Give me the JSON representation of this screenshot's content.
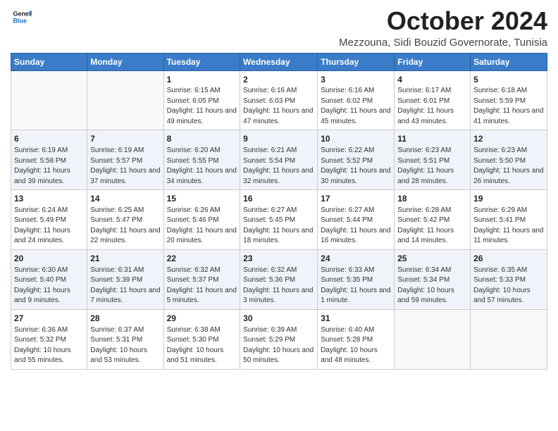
{
  "header": {
    "logo_line1": "General",
    "logo_line2": "Blue",
    "month_title": "October 2024",
    "subtitle": "Mezzouna, Sidi Bouzid Governorate, Tunisia"
  },
  "weekdays": [
    "Sunday",
    "Monday",
    "Tuesday",
    "Wednesday",
    "Thursday",
    "Friday",
    "Saturday"
  ],
  "weeks": [
    [
      {
        "day": "",
        "info": ""
      },
      {
        "day": "",
        "info": ""
      },
      {
        "day": "1",
        "info": "Sunrise: 6:15 AM\nSunset: 6:05 PM\nDaylight: 11 hours and 49 minutes."
      },
      {
        "day": "2",
        "info": "Sunrise: 6:16 AM\nSunset: 6:03 PM\nDaylight: 11 hours and 47 minutes."
      },
      {
        "day": "3",
        "info": "Sunrise: 6:16 AM\nSunset: 6:02 PM\nDaylight: 11 hours and 45 minutes."
      },
      {
        "day": "4",
        "info": "Sunrise: 6:17 AM\nSunset: 6:01 PM\nDaylight: 11 hours and 43 minutes."
      },
      {
        "day": "5",
        "info": "Sunrise: 6:18 AM\nSunset: 5:59 PM\nDaylight: 11 hours and 41 minutes."
      }
    ],
    [
      {
        "day": "6",
        "info": "Sunrise: 6:19 AM\nSunset: 5:58 PM\nDaylight: 11 hours and 39 minutes."
      },
      {
        "day": "7",
        "info": "Sunrise: 6:19 AM\nSunset: 5:57 PM\nDaylight: 11 hours and 37 minutes."
      },
      {
        "day": "8",
        "info": "Sunrise: 6:20 AM\nSunset: 5:55 PM\nDaylight: 11 hours and 34 minutes."
      },
      {
        "day": "9",
        "info": "Sunrise: 6:21 AM\nSunset: 5:54 PM\nDaylight: 11 hours and 32 minutes."
      },
      {
        "day": "10",
        "info": "Sunrise: 6:22 AM\nSunset: 5:52 PM\nDaylight: 11 hours and 30 minutes."
      },
      {
        "day": "11",
        "info": "Sunrise: 6:23 AM\nSunset: 5:51 PM\nDaylight: 11 hours and 28 minutes."
      },
      {
        "day": "12",
        "info": "Sunrise: 6:23 AM\nSunset: 5:50 PM\nDaylight: 11 hours and 26 minutes."
      }
    ],
    [
      {
        "day": "13",
        "info": "Sunrise: 6:24 AM\nSunset: 5:49 PM\nDaylight: 11 hours and 24 minutes."
      },
      {
        "day": "14",
        "info": "Sunrise: 6:25 AM\nSunset: 5:47 PM\nDaylight: 11 hours and 22 minutes."
      },
      {
        "day": "15",
        "info": "Sunrise: 6:26 AM\nSunset: 5:46 PM\nDaylight: 11 hours and 20 minutes."
      },
      {
        "day": "16",
        "info": "Sunrise: 6:27 AM\nSunset: 5:45 PM\nDaylight: 11 hours and 18 minutes."
      },
      {
        "day": "17",
        "info": "Sunrise: 6:27 AM\nSunset: 5:44 PM\nDaylight: 11 hours and 16 minutes."
      },
      {
        "day": "18",
        "info": "Sunrise: 6:28 AM\nSunset: 5:42 PM\nDaylight: 11 hours and 14 minutes."
      },
      {
        "day": "19",
        "info": "Sunrise: 6:29 AM\nSunset: 5:41 PM\nDaylight: 11 hours and 11 minutes."
      }
    ],
    [
      {
        "day": "20",
        "info": "Sunrise: 6:30 AM\nSunset: 5:40 PM\nDaylight: 11 hours and 9 minutes."
      },
      {
        "day": "21",
        "info": "Sunrise: 6:31 AM\nSunset: 5:39 PM\nDaylight: 11 hours and 7 minutes."
      },
      {
        "day": "22",
        "info": "Sunrise: 6:32 AM\nSunset: 5:37 PM\nDaylight: 11 hours and 5 minutes."
      },
      {
        "day": "23",
        "info": "Sunrise: 6:32 AM\nSunset: 5:36 PM\nDaylight: 11 hours and 3 minutes."
      },
      {
        "day": "24",
        "info": "Sunrise: 6:33 AM\nSunset: 5:35 PM\nDaylight: 11 hours and 1 minute."
      },
      {
        "day": "25",
        "info": "Sunrise: 6:34 AM\nSunset: 5:34 PM\nDaylight: 10 hours and 59 minutes."
      },
      {
        "day": "26",
        "info": "Sunrise: 6:35 AM\nSunset: 5:33 PM\nDaylight: 10 hours and 57 minutes."
      }
    ],
    [
      {
        "day": "27",
        "info": "Sunrise: 6:36 AM\nSunset: 5:32 PM\nDaylight: 10 hours and 55 minutes."
      },
      {
        "day": "28",
        "info": "Sunrise: 6:37 AM\nSunset: 5:31 PM\nDaylight: 10 hours and 53 minutes."
      },
      {
        "day": "29",
        "info": "Sunrise: 6:38 AM\nSunset: 5:30 PM\nDaylight: 10 hours and 51 minutes."
      },
      {
        "day": "30",
        "info": "Sunrise: 6:39 AM\nSunset: 5:29 PM\nDaylight: 10 hours and 50 minutes."
      },
      {
        "day": "31",
        "info": "Sunrise: 6:40 AM\nSunset: 5:28 PM\nDaylight: 10 hours and 48 minutes."
      },
      {
        "day": "",
        "info": ""
      },
      {
        "day": "",
        "info": ""
      }
    ]
  ]
}
